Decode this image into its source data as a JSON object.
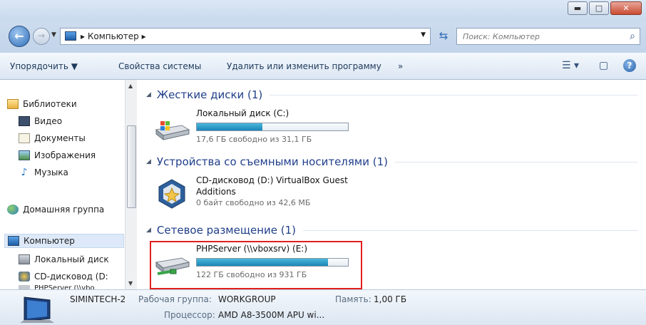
{
  "window": {
    "buttons": {
      "minimize": "▬",
      "maximize": "□",
      "close": "✕"
    }
  },
  "address": {
    "path_separator": "▸",
    "location": "Компьютер",
    "trail_separator": "▸",
    "dropdown": "▼",
    "search_placeholder": "Поиск: Компьютер"
  },
  "toolbar": {
    "organize": "Упорядочить ▼",
    "system_properties": "Свойства системы",
    "uninstall": "Удалить или изменить программу",
    "more": "»"
  },
  "nav": {
    "libraries": "Библиотеки",
    "video": "Видео",
    "documents": "Документы",
    "images": "Изображения",
    "music": "Музыка",
    "homegroup": "Домашняя группа",
    "computer": "Компьютер",
    "local_disk": "Локальный диск",
    "cd_drive": "CD-дисковод (D:",
    "php_server": "PHPServer (\\\\vbo"
  },
  "groups": {
    "hard_disks": "Жесткие диски (1)",
    "removable": "Устройства со съемными носителями (1)",
    "network": "Сетевое размещение (1)"
  },
  "drives": {
    "c": {
      "name": "Локальный диск (C:)",
      "free": "17,6 ГБ свободно из 31,1 ГБ",
      "used_fraction": 0.434
    },
    "d": {
      "name_line1": "CD-дисковод (D:) VirtualBox Guest",
      "name_line2": "Additions",
      "free": "0 байт свободно из 42,6 МБ"
    },
    "e": {
      "name": "PHPServer (\\\\vboxsrv) (E:)",
      "free": "122 ГБ свободно из 931 ГБ",
      "used_fraction": 0.869
    }
  },
  "details": {
    "computer_name": "SIMINTECH-2",
    "workgroup_label": "Рабочая группа:",
    "workgroup_value": "WORKGROUP",
    "memory_label": "Память:",
    "memory_value": "1,00 ГБ",
    "processor_label": "Процессор:",
    "processor_value": "AMD A8-3500M APU wi..."
  },
  "colors": {
    "accent": "#1a86b8",
    "highlight": "#e0201c",
    "group_title": "#1f3e8a"
  }
}
